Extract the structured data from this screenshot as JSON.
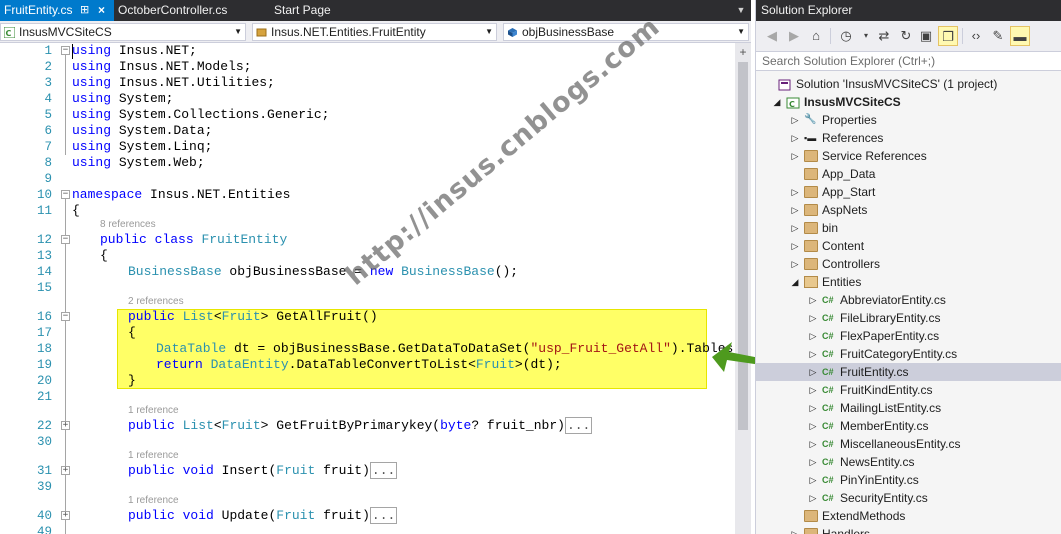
{
  "tabs": [
    {
      "label": "FruitEntity.cs",
      "pin": "⊞",
      "close": "×",
      "active": true
    },
    {
      "label": "OctoberController.cs",
      "active": false
    },
    {
      "label": "Start Page",
      "active": false
    }
  ],
  "navbar": {
    "project": "InsusMVCSiteCS",
    "class": "Insus.NET.Entities.FruitEntity",
    "member": "objBusinessBase"
  },
  "code_lines": [
    {
      "n": "1",
      "text": "using Insus.NET;"
    },
    {
      "n": "2",
      "text": "using Insus.NET.Models;"
    },
    {
      "n": "3",
      "text": "using Insus.NET.Utilities;"
    },
    {
      "n": "4",
      "text": "using System;"
    },
    {
      "n": "5",
      "text": "using System.Collections.Generic;"
    },
    {
      "n": "6",
      "text": "using System.Data;"
    },
    {
      "n": "7",
      "text": "using System.Linq;"
    },
    {
      "n": "8",
      "text": "using System.Web;"
    },
    {
      "n": "9",
      "text": ""
    },
    {
      "n": "10",
      "text": "namespace Insus.NET.Entities"
    },
    {
      "n": "11",
      "text": "{"
    },
    {
      "n": "12",
      "text": "public class FruitEntity",
      "lens": "8 references"
    },
    {
      "n": "13",
      "text": "{"
    },
    {
      "n": "14",
      "text": "BusinessBase objBusinessBase = new BusinessBase();"
    },
    {
      "n": "15",
      "text": ""
    },
    {
      "n": "16",
      "text": "public List<Fruit> GetAllFruit()",
      "lens": "2 references"
    },
    {
      "n": "17",
      "text": "{"
    },
    {
      "n": "18",
      "text": "DataTable dt = objBusinessBase.GetDataToDataSet(\"usp_Fruit_GetAll\").Tables[0];"
    },
    {
      "n": "19",
      "text": "return DataEntity.DataTableConvertToList<Fruit>(dt);"
    },
    {
      "n": "20",
      "text": "}"
    },
    {
      "n": "21",
      "text": ""
    },
    {
      "n": "22",
      "text": "public List<Fruit> GetFruitByPrimarykey(byte? fruit_nbr)",
      "lens": "1 reference",
      "collapsed": "..."
    },
    {
      "n": "30",
      "text": ""
    },
    {
      "n": "31",
      "text": "public void Insert(Fruit fruit)",
      "lens": "1 reference",
      "collapsed": "..."
    },
    {
      "n": "39",
      "text": ""
    },
    {
      "n": "40",
      "text": "public void Update(Fruit fruit)",
      "lens": "1 reference",
      "collapsed": "..."
    },
    {
      "n": "49",
      "text": ""
    }
  ],
  "watermark": "http://insus.cnblogs.com",
  "solution_explorer": {
    "title": "Solution Explorer",
    "search_placeholder": "Search Solution Explorer (Ctrl+;)",
    "toolbar_icons": [
      "back-icon",
      "forward-icon",
      "home-icon",
      "history-icon",
      "sync-icon",
      "pending-changes-icon",
      "collapse-all-icon",
      "show-all-files-icon",
      "code-view-icon",
      "properties-icon",
      "preview-icon"
    ],
    "tree": [
      {
        "label": "Solution 'InsusMVCSiteCS' (1 project)",
        "level": 0,
        "icon": "solution",
        "exp": ""
      },
      {
        "label": "InsusMVCSiteCS",
        "level": 1,
        "icon": "project",
        "exp": "open",
        "bold": true
      },
      {
        "label": "Properties",
        "level": 2,
        "icon": "wrench",
        "exp": "closed"
      },
      {
        "label": "References",
        "level": 2,
        "icon": "references",
        "exp": "closed"
      },
      {
        "label": "Service References",
        "level": 2,
        "icon": "folder",
        "exp": "closed"
      },
      {
        "label": "App_Data",
        "level": 2,
        "icon": "folder",
        "exp": ""
      },
      {
        "label": "App_Start",
        "level": 2,
        "icon": "folder",
        "exp": "closed"
      },
      {
        "label": "AspNets",
        "level": 2,
        "icon": "folder",
        "exp": "closed"
      },
      {
        "label": "bin",
        "level": 2,
        "icon": "folder",
        "exp": "closed"
      },
      {
        "label": "Content",
        "level": 2,
        "icon": "folder",
        "exp": "closed"
      },
      {
        "label": "Controllers",
        "level": 2,
        "icon": "folder",
        "exp": "closed"
      },
      {
        "label": "Entities",
        "level": 2,
        "icon": "folder-open",
        "exp": "open"
      },
      {
        "label": "AbbreviatorEntity.cs",
        "level": 3,
        "icon": "cs",
        "exp": "closed"
      },
      {
        "label": "FileLibraryEntity.cs",
        "level": 3,
        "icon": "cs",
        "exp": "closed"
      },
      {
        "label": "FlexPaperEntity.cs",
        "level": 3,
        "icon": "cs",
        "exp": "closed"
      },
      {
        "label": "FruitCategoryEntity.cs",
        "level": 3,
        "icon": "cs",
        "exp": "closed"
      },
      {
        "label": "FruitEntity.cs",
        "level": 3,
        "icon": "cs",
        "exp": "closed",
        "selected": true
      },
      {
        "label": "FruitKindEntity.cs",
        "level": 3,
        "icon": "cs",
        "exp": "closed"
      },
      {
        "label": "MailingListEntity.cs",
        "level": 3,
        "icon": "cs",
        "exp": "closed"
      },
      {
        "label": "MemberEntity.cs",
        "level": 3,
        "icon": "cs",
        "exp": "closed"
      },
      {
        "label": "MiscellaneousEntity.cs",
        "level": 3,
        "icon": "cs",
        "exp": "closed"
      },
      {
        "label": "NewsEntity.cs",
        "level": 3,
        "icon": "cs",
        "exp": "closed"
      },
      {
        "label": "PinYinEntity.cs",
        "level": 3,
        "icon": "cs",
        "exp": "closed"
      },
      {
        "label": "SecurityEntity.cs",
        "level": 3,
        "icon": "cs",
        "exp": "closed"
      },
      {
        "label": "ExtendMethods",
        "level": 2,
        "icon": "folder",
        "exp": ""
      },
      {
        "label": "Handlers",
        "level": 2,
        "icon": "folder",
        "exp": "closed"
      }
    ]
  },
  "colors": {
    "active_tab": "#007acc",
    "title_bar": "#2d2d30",
    "highlight": "#ffff66",
    "arrow": "#4e9a1e",
    "keyword": "#0000ff",
    "type": "#2b91af",
    "string": "#a31515"
  }
}
